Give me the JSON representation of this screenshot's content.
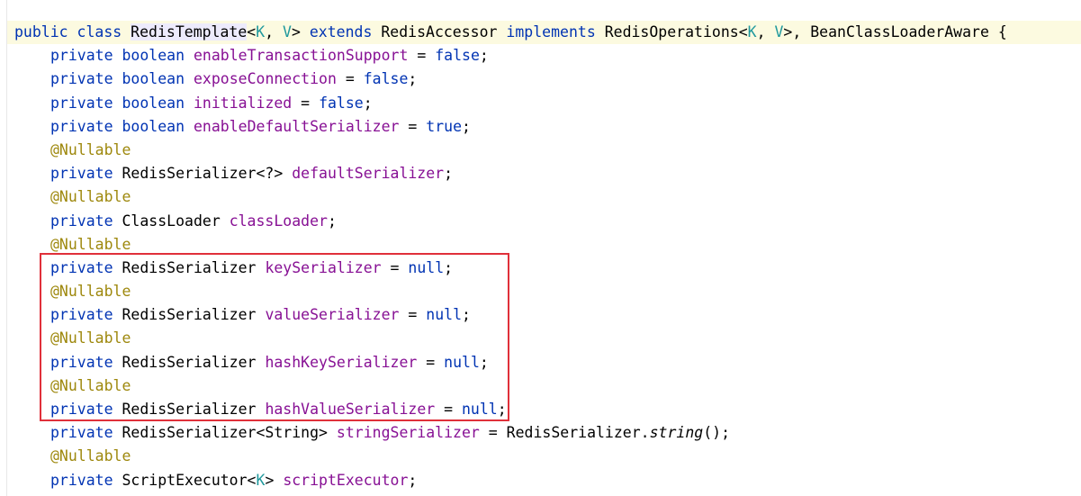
{
  "lines": [
    {
      "tokens": [
        {
          "t": "public",
          "c": "kw"
        },
        {
          "t": " "
        },
        {
          "t": "class",
          "c": "kw"
        },
        {
          "t": " "
        },
        {
          "t": "RedisTemplate",
          "c": "type cls-hl"
        },
        {
          "t": "<"
        },
        {
          "t": "K",
          "c": "tp"
        },
        {
          "t": ", "
        },
        {
          "t": "V",
          "c": "tp"
        },
        {
          "t": "> "
        },
        {
          "t": "extends",
          "c": "kw"
        },
        {
          "t": " RedisAccessor "
        },
        {
          "t": "implements",
          "c": "kw"
        },
        {
          "t": " RedisOperations<"
        },
        {
          "t": "K",
          "c": "tp"
        },
        {
          "t": ", "
        },
        {
          "t": "V",
          "c": "tp"
        },
        {
          "t": ">, BeanClassLoaderAware {"
        }
      ]
    },
    {
      "indent": true,
      "tokens": [
        {
          "t": "private",
          "c": "kw"
        },
        {
          "t": " "
        },
        {
          "t": "boolean",
          "c": "kw"
        },
        {
          "t": " "
        },
        {
          "t": "enableTransactionSupport",
          "c": "field"
        },
        {
          "t": " = "
        },
        {
          "t": "false",
          "c": "kw"
        },
        {
          "t": ";"
        }
      ]
    },
    {
      "indent": true,
      "tokens": [
        {
          "t": "private",
          "c": "kw"
        },
        {
          "t": " "
        },
        {
          "t": "boolean",
          "c": "kw"
        },
        {
          "t": " "
        },
        {
          "t": "exposeConnection",
          "c": "field"
        },
        {
          "t": " = "
        },
        {
          "t": "false",
          "c": "kw"
        },
        {
          "t": ";"
        }
      ]
    },
    {
      "indent": true,
      "tokens": [
        {
          "t": "private",
          "c": "kw"
        },
        {
          "t": " "
        },
        {
          "t": "boolean",
          "c": "kw"
        },
        {
          "t": " "
        },
        {
          "t": "initialized",
          "c": "field"
        },
        {
          "t": " = "
        },
        {
          "t": "false",
          "c": "kw"
        },
        {
          "t": ";"
        }
      ]
    },
    {
      "indent": true,
      "tokens": [
        {
          "t": "private",
          "c": "kw"
        },
        {
          "t": " "
        },
        {
          "t": "boolean",
          "c": "kw"
        },
        {
          "t": " "
        },
        {
          "t": "enableDefaultSerializer",
          "c": "field"
        },
        {
          "t": " = "
        },
        {
          "t": "true",
          "c": "kw"
        },
        {
          "t": ";"
        }
      ]
    },
    {
      "indent": true,
      "tokens": [
        {
          "t": "@Nullable",
          "c": "ann"
        }
      ]
    },
    {
      "indent": true,
      "tokens": [
        {
          "t": "private",
          "c": "kw"
        },
        {
          "t": " RedisSerializer<?> "
        },
        {
          "t": "defaultSerializer",
          "c": "field"
        },
        {
          "t": ";"
        }
      ]
    },
    {
      "indent": true,
      "tokens": [
        {
          "t": "@Nullable",
          "c": "ann"
        }
      ]
    },
    {
      "indent": true,
      "tokens": [
        {
          "t": "private",
          "c": "kw"
        },
        {
          "t": " ClassLoader "
        },
        {
          "t": "classLoader",
          "c": "field"
        },
        {
          "t": ";"
        }
      ]
    },
    {
      "indent": true,
      "tokens": [
        {
          "t": "@Nullable",
          "c": "ann"
        }
      ]
    },
    {
      "indent": true,
      "tokens": [
        {
          "t": "private",
          "c": "kw"
        },
        {
          "t": " RedisSerializer "
        },
        {
          "t": "keySerializer",
          "c": "field"
        },
        {
          "t": " = "
        },
        {
          "t": "null",
          "c": "kw"
        },
        {
          "t": ";"
        }
      ]
    },
    {
      "indent": true,
      "tokens": [
        {
          "t": "@Nullable",
          "c": "ann"
        }
      ]
    },
    {
      "indent": true,
      "tokens": [
        {
          "t": "private",
          "c": "kw"
        },
        {
          "t": " RedisSerializer "
        },
        {
          "t": "valueSerializer",
          "c": "field"
        },
        {
          "t": " = "
        },
        {
          "t": "null",
          "c": "kw"
        },
        {
          "t": ";"
        }
      ]
    },
    {
      "indent": true,
      "tokens": [
        {
          "t": "@Nullable",
          "c": "ann"
        }
      ]
    },
    {
      "indent": true,
      "tokens": [
        {
          "t": "private",
          "c": "kw"
        },
        {
          "t": " RedisSerializer "
        },
        {
          "t": "hashKeySerializer",
          "c": "field"
        },
        {
          "t": " = "
        },
        {
          "t": "null",
          "c": "kw"
        },
        {
          "t": ";"
        }
      ]
    },
    {
      "indent": true,
      "tokens": [
        {
          "t": "@Nullable",
          "c": "ann"
        }
      ]
    },
    {
      "indent": true,
      "tokens": [
        {
          "t": "private",
          "c": "kw"
        },
        {
          "t": " RedisSerializer "
        },
        {
          "t": "hashValueSerializer",
          "c": "field"
        },
        {
          "t": " = "
        },
        {
          "t": "null",
          "c": "kw"
        },
        {
          "t": ";"
        }
      ]
    },
    {
      "indent": true,
      "tokens": [
        {
          "t": "private",
          "c": "kw"
        },
        {
          "t": " RedisSerializer<String> "
        },
        {
          "t": "stringSerializer",
          "c": "field"
        },
        {
          "t": " = RedisSerializer."
        },
        {
          "t": "string",
          "c": "it"
        },
        {
          "t": "();"
        }
      ]
    },
    {
      "indent": true,
      "tokens": [
        {
          "t": "@Nullable",
          "c": "ann"
        }
      ]
    },
    {
      "indent": true,
      "tokens": [
        {
          "t": "private",
          "c": "kw"
        },
        {
          "t": " ScriptExecutor<"
        },
        {
          "t": "K",
          "c": "tp"
        },
        {
          "t": "> "
        },
        {
          "t": "scriptExecutor",
          "c": "field"
        },
        {
          "t": ";"
        }
      ]
    }
  ],
  "colors": {
    "keyword": "#0033b3",
    "field": "#871094",
    "annotation": "#9e880d",
    "type_param": "#20999d",
    "highlight_box": "#e0303a",
    "current_line": "#fcfae0"
  }
}
